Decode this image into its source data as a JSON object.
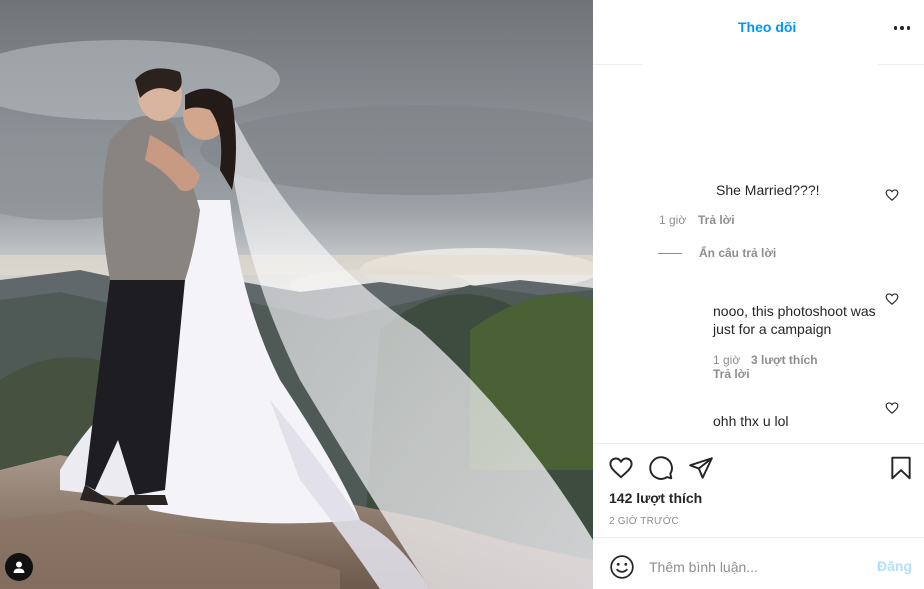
{
  "header": {
    "follow_label": "Theo dõi",
    "more_icon": "more-options-icon"
  },
  "comments": [
    {
      "text": "She Married???!",
      "time": "1 giờ",
      "reply_label": "Trả lời",
      "hide_replies_label": "Ẩn câu trả lời"
    },
    {
      "text": "nooo, this photoshoot was just for a campaign",
      "time": "1 giờ",
      "likes": "3 lượt thích",
      "reply_label": "Trả lời"
    },
    {
      "text": "ohh thx u lol"
    }
  ],
  "actions": {
    "like_icon": "heart-icon",
    "comment_icon": "comment-icon",
    "share_icon": "send-icon",
    "save_icon": "bookmark-icon"
  },
  "post": {
    "likes": "142 lượt thích",
    "time": "2 GIỜ TRƯỚC"
  },
  "add_comment": {
    "placeholder": "Thêm bình luận...",
    "post_label": "Đăng"
  },
  "colors": {
    "accent": "#0095f6",
    "post_disabled": "#b2dffc",
    "text": "#262626",
    "muted": "#8e8e8e"
  }
}
